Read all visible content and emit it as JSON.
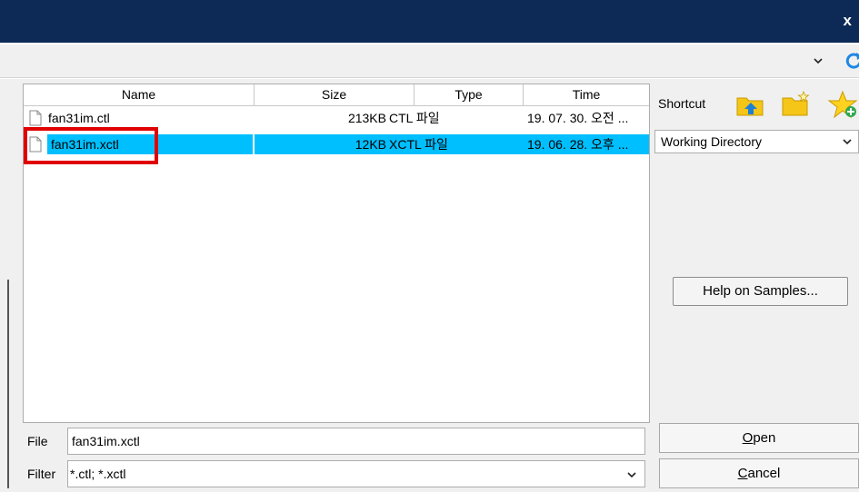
{
  "titlebar": {
    "close_glyph": "x"
  },
  "file_list": {
    "columns": [
      "Name",
      "Size",
      "Type",
      "Time"
    ],
    "rows": [
      {
        "name": "fan31im.ctl",
        "size": "213KB",
        "type": "CTL 파일",
        "time": "19. 07. 30. 오전 ...",
        "selected": false
      },
      {
        "name": "fan31im.xctl",
        "size": "12KB",
        "type": "XCTL 파일",
        "time": "19. 06. 28. 오후 ...",
        "selected": true
      }
    ]
  },
  "shortcut": {
    "label": "Shortcut",
    "icons": [
      "folder-up-icon",
      "new-folder-icon",
      "add-favorite-star-icon"
    ],
    "directory_value": "Working Directory"
  },
  "help_button": {
    "label": "Help on Samples..."
  },
  "file_field": {
    "label": "File",
    "value": "fan31im.xctl"
  },
  "filter_field": {
    "label": "Filter",
    "value": "*.ctl; *.xctl"
  },
  "buttons": {
    "open": {
      "mnemonic": "O",
      "rest": "pen"
    },
    "cancel": {
      "mnemonic": "C",
      "rest": "ancel"
    }
  },
  "colors": {
    "titlebar": "#0c2a55",
    "selection": "#00bfff",
    "highlight_box": "#e00000",
    "folder_yellow": "#f5c518",
    "arrow_blue": "#1e7fd6"
  }
}
